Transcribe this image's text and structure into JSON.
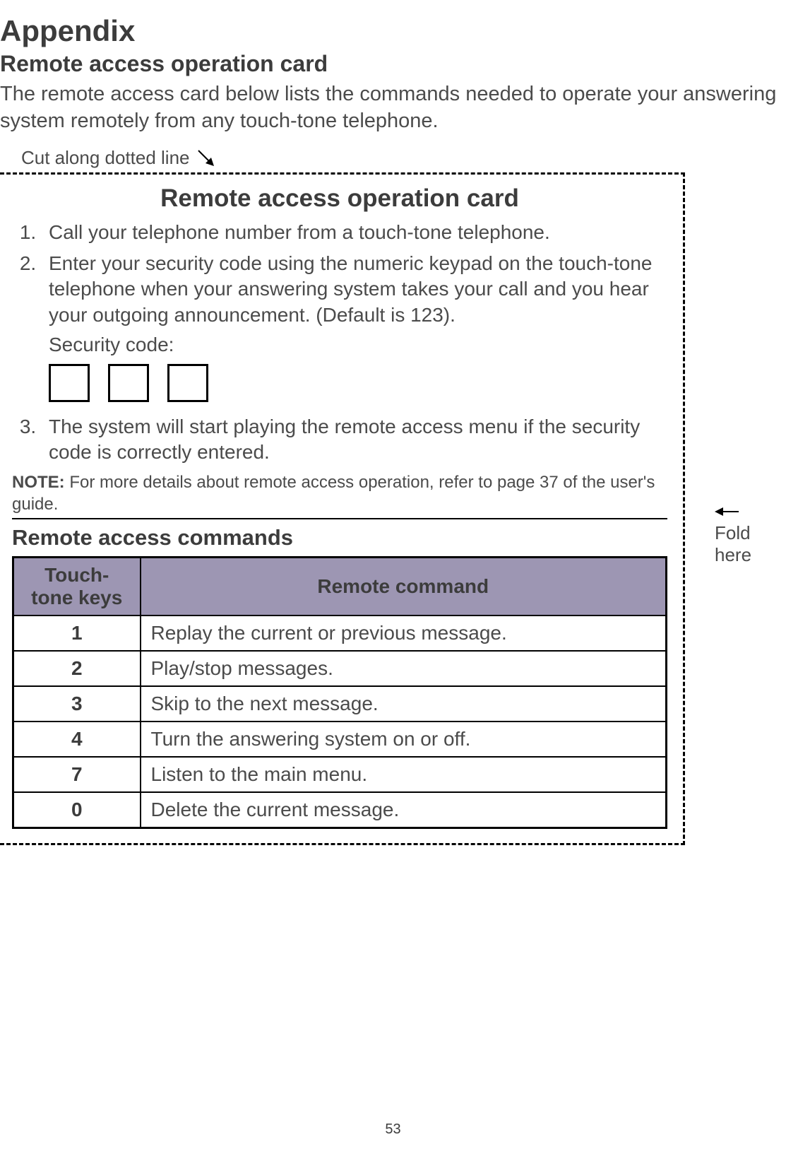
{
  "header": {
    "appendix": "Appendix",
    "section": "Remote access operation card",
    "intro": "The remote access card below lists the commands needed to operate your answering system remotely from any touch-tone telephone."
  },
  "cut_label": "Cut along dotted line",
  "card": {
    "title": "Remote access operation card",
    "steps": {
      "s1": "Call your telephone number from a touch-tone telephone.",
      "s2": "Enter your security code using the numeric keypad on the touch-tone telephone when your answering system takes your call and you hear your outgoing announcement. (Default is 123).",
      "s2_sec_label": "Security code:",
      "s3": "The system will start playing the remote access menu if the security code is correctly entered."
    },
    "note_label": "NOTE:",
    "note_text": " For more details about remote access operation, refer to page 37 of the user's guide.",
    "commands_title": "Remote access commands",
    "table": {
      "h1": "Touch-tone keys",
      "h2": "Remote command",
      "rows": [
        {
          "key": "1",
          "cmd": "Replay the current or previous message."
        },
        {
          "key": "2",
          "cmd": "Play/stop messages."
        },
        {
          "key": "3",
          "cmd": "Skip to the next message."
        },
        {
          "key": "4",
          "cmd": "Turn the answering system on or off."
        },
        {
          "key": "7",
          "cmd": "Listen to the main menu."
        },
        {
          "key": "0",
          "cmd": "Delete the current message."
        }
      ]
    }
  },
  "fold_label_1": "Fold",
  "fold_label_2": "here",
  "page_number": "53"
}
